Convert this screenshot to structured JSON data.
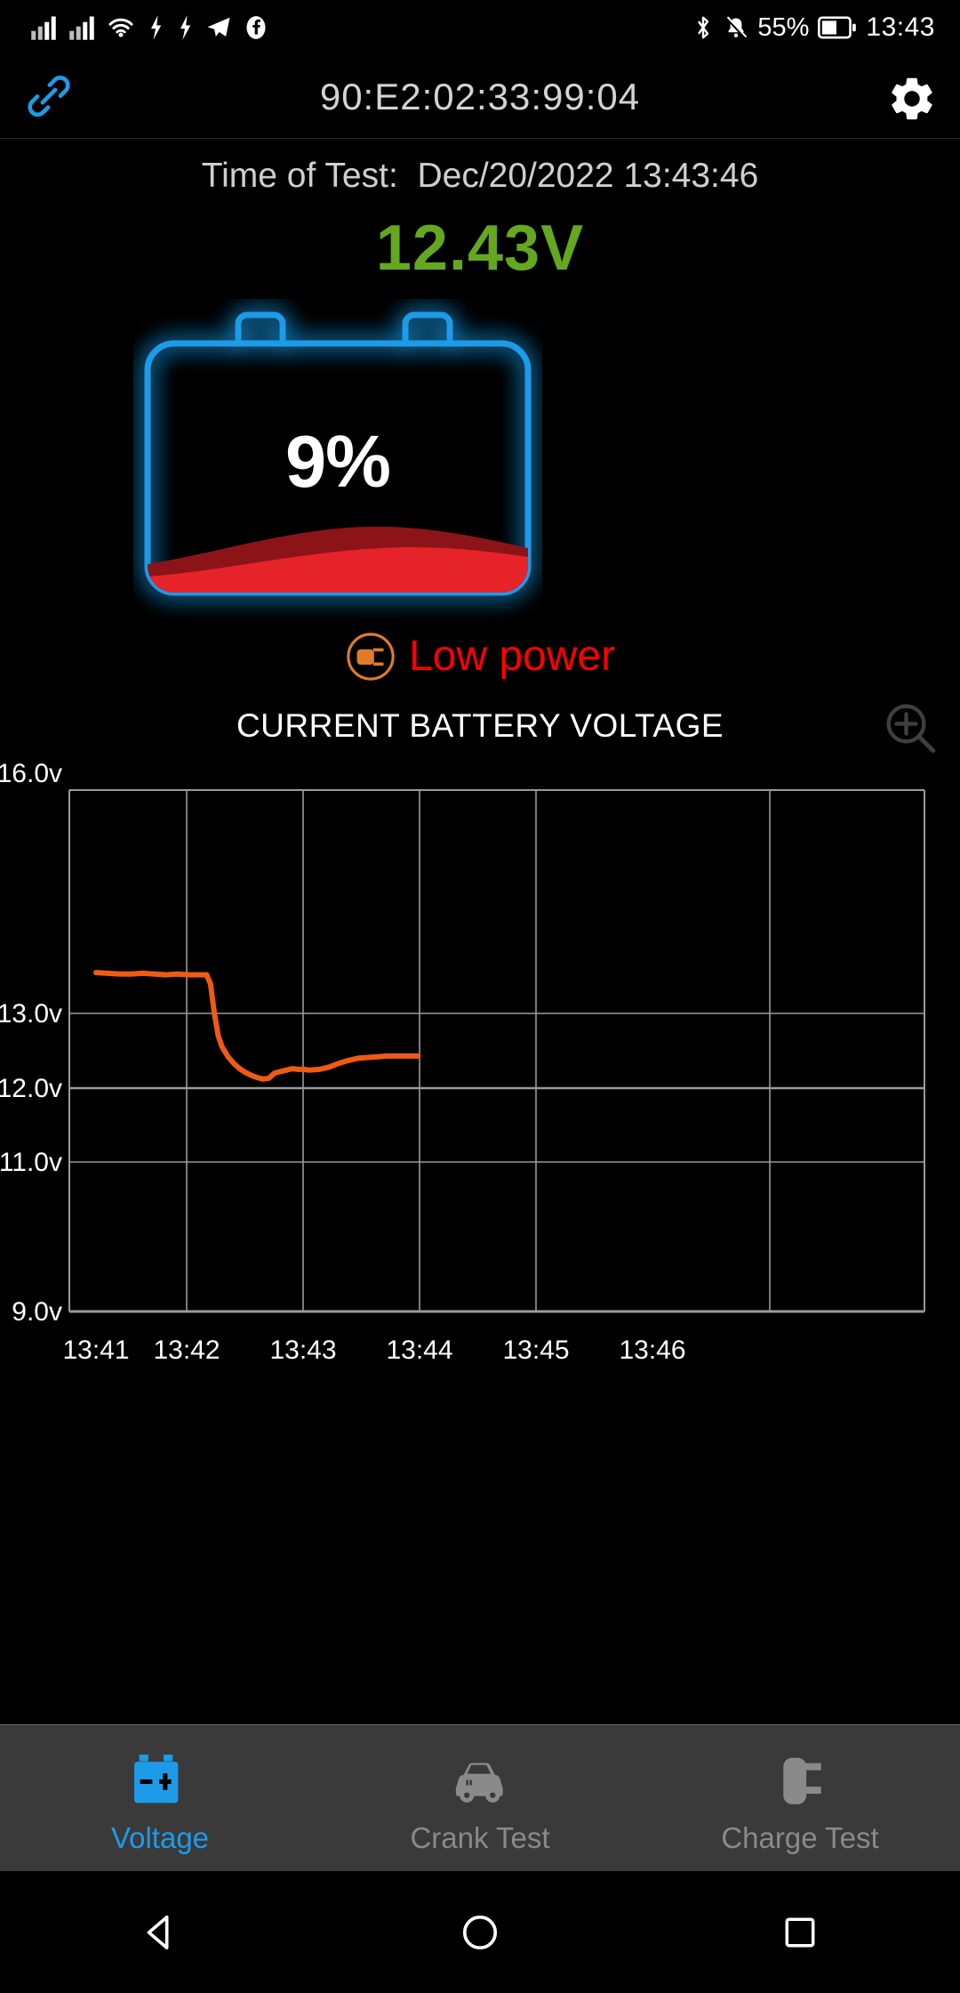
{
  "status_bar": {
    "left_icons": [
      "signal-bars-icon",
      "signal-bars-icon",
      "wifi-icon",
      "bolt-icon",
      "bolt-icon",
      "telegram-icon",
      "facebook-icon"
    ],
    "right_icons": [
      "bluetooth-icon",
      "bell-muted-icon",
      "battery-icon"
    ],
    "battery_percent": "55%",
    "clock": "13:43"
  },
  "title_bar": {
    "link_icon": "link-icon",
    "device_mac": "90:E2:02:33:99:04",
    "settings_icon": "gear-icon"
  },
  "main": {
    "time_of_test": "Time of Test:  Dec/20/2022 13:43:46",
    "voltage_value": "12.43V",
    "battery_percent": "9%",
    "status_icon": "plug-circle-icon",
    "status_text": "Low power",
    "chart_title": "CURRENT BATTERY VOLTAGE",
    "chart_zoom_icon": "zoom-in-icon"
  },
  "colors": {
    "accent_blue": "#1e9be8",
    "voltage_green": "#63a81f",
    "alert_red": "#ff0000",
    "plug_orange": "#e07b2a",
    "battery_fill_front": "#e62329",
    "battery_fill_back": "#8c1418",
    "chart_line": "#f05a14",
    "grid": "#9a9a9a",
    "tab_bar_bg": "#3a3a3a",
    "tab_inactive": "#8a8a8a"
  },
  "chart_data": {
    "type": "line",
    "title": "CURRENT BATTERY VOLTAGE",
    "xlabel": "",
    "ylabel": "",
    "grid": true,
    "legend": "none",
    "ylim": [
      9.0,
      16.0
    ],
    "y_ticks": [
      "16.0v",
      "13.0v",
      "12.0v",
      "11.0v",
      "9.0v"
    ],
    "y_tick_values": [
      16.0,
      13.0,
      12.0,
      11.0,
      9.0
    ],
    "x_ticks": [
      "13:41",
      "13:42",
      "13:43",
      "13:44",
      "13:45",
      "13:46"
    ],
    "xlim": [
      "13:41",
      "13:46"
    ],
    "series": [
      {
        "name": "Battery Voltage",
        "color": "#f05a14",
        "x": [
          "13:41:00",
          "13:41:06",
          "13:41:12",
          "13:41:18",
          "13:41:24",
          "13:41:30",
          "13:41:36",
          "13:41:42",
          "13:41:48",
          "13:41:54",
          "13:41:57",
          "13:41:59",
          "13:42:01",
          "13:42:03",
          "13:42:05",
          "13:42:08",
          "13:42:11",
          "13:42:14",
          "13:42:17",
          "13:42:20",
          "13:42:23",
          "13:42:26",
          "13:42:29",
          "13:42:32",
          "13:42:35",
          "13:42:38",
          "13:42:41",
          "13:42:44",
          "13:42:47",
          "13:42:50",
          "13:42:55",
          "13:43:00",
          "13:43:05",
          "13:43:10",
          "13:43:15",
          "13:43:20",
          "13:43:25",
          "13:43:30",
          "13:43:40",
          "13:43:46"
        ],
        "values": [
          13.55,
          13.54,
          13.53,
          13.53,
          13.54,
          13.53,
          13.52,
          13.53,
          13.52,
          13.52,
          13.52,
          13.4,
          13.0,
          12.7,
          12.55,
          12.42,
          12.33,
          12.26,
          12.21,
          12.17,
          12.14,
          12.12,
          12.13,
          12.2,
          12.22,
          12.24,
          12.26,
          12.25,
          12.25,
          12.24,
          12.25,
          12.28,
          12.33,
          12.37,
          12.4,
          12.41,
          12.42,
          12.43,
          12.43,
          12.43
        ]
      }
    ]
  },
  "tabs": [
    {
      "label": "Voltage",
      "icon": "car-battery-icon",
      "active": true
    },
    {
      "label": "Crank Test",
      "icon": "car-icon",
      "active": false
    },
    {
      "label": "Charge Test",
      "icon": "plug-icon",
      "active": false
    }
  ],
  "android_nav": {
    "back": "back-triangle-icon",
    "home": "home-circle-icon",
    "recents": "recents-square-icon"
  }
}
